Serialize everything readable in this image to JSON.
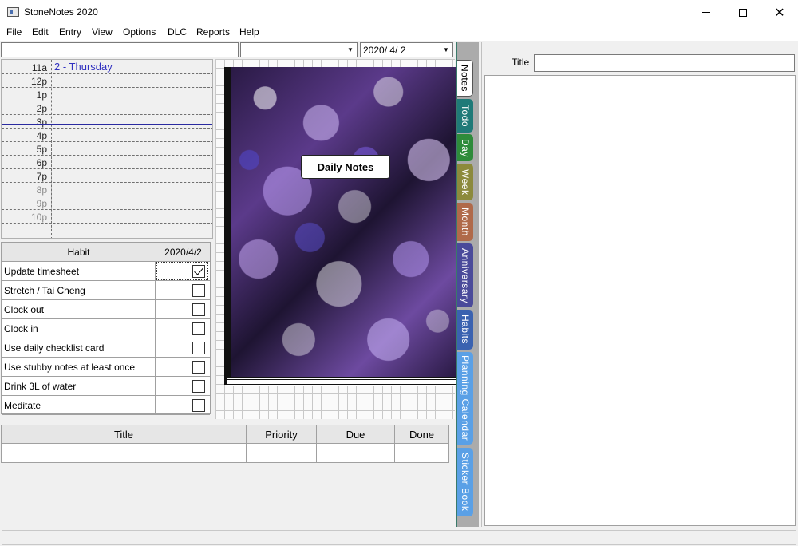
{
  "window": {
    "title": "StoneNotes 2020"
  },
  "menu": [
    "File",
    "Edit",
    "Entry",
    "View",
    "Options",
    "DLC",
    "Reports",
    "Help"
  ],
  "toolbar": {
    "search_value": "",
    "filter_value": "",
    "date_value": "2020/  4/  2"
  },
  "schedule": {
    "header": "2 -  Thursday",
    "times": [
      "11a",
      "12p",
      "1p",
      "2p",
      "3p",
      "4p",
      "5p",
      "6p",
      "7p",
      "8p",
      "9p",
      "10p"
    ]
  },
  "habits": {
    "col_habit": "Habit",
    "col_date": "2020/4/2",
    "rows": [
      {
        "name": "Update timesheet",
        "checked": true
      },
      {
        "name": "Stretch / Tai Cheng",
        "checked": false
      },
      {
        "name": "Clock out",
        "checked": false
      },
      {
        "name": "Clock in",
        "checked": false
      },
      {
        "name": "Use daily checklist card",
        "checked": false
      },
      {
        "name": "Use stubby notes at least once",
        "checked": false
      },
      {
        "name": "Drink 3L of water",
        "checked": false
      },
      {
        "name": "Meditate",
        "checked": false
      }
    ]
  },
  "notebook": {
    "label": "Daily Notes"
  },
  "todo": {
    "columns": [
      "Title",
      "Priority",
      "Due",
      "Done"
    ]
  },
  "tabs": [
    {
      "label": "Notes",
      "color": "#ffffff",
      "active": true
    },
    {
      "label": "Todo",
      "color": "#1f7a78"
    },
    {
      "label": "Day",
      "color": "#2e8b3a"
    },
    {
      "label": "Week",
      "color": "#8c8a3c"
    },
    {
      "label": "Month",
      "color": "#b06a4a"
    },
    {
      "label": "Anniversary",
      "color": "#4a4a9a"
    },
    {
      "label": "Habits",
      "color": "#3a62b0"
    },
    {
      "label": "Planning Calendar",
      "color": "#5aa0e6"
    },
    {
      "label": "Sticker Book",
      "color": "#5aa0e6"
    }
  ],
  "note": {
    "title_label": "Title",
    "title_value": ""
  }
}
